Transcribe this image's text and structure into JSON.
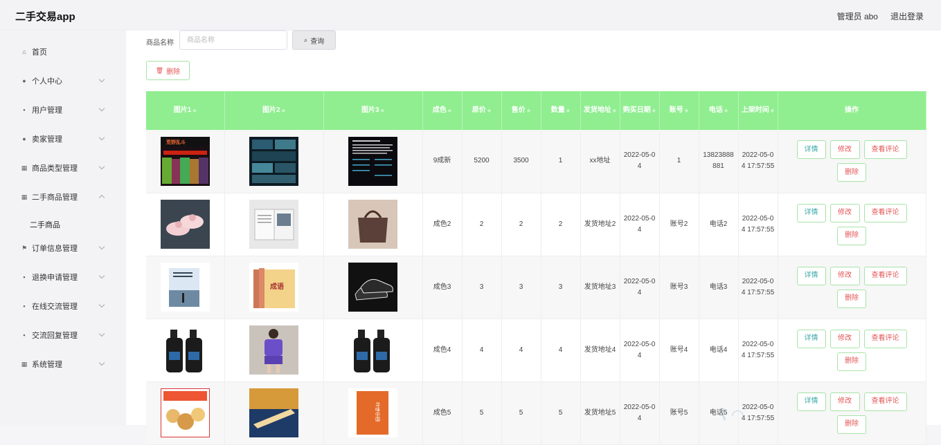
{
  "app": {
    "title": "二手交易app"
  },
  "header": {
    "user": "管理员 abo",
    "logout": "退出登录"
  },
  "sidebar": {
    "items": [
      {
        "label": "首页",
        "icon": "home-icon",
        "has_children": false
      },
      {
        "label": "个人中心",
        "icon": "user-icon",
        "has_children": true
      },
      {
        "label": "用户管理",
        "icon": "user-manage-icon",
        "has_children": true
      },
      {
        "label": "卖家管理",
        "icon": "seller-icon",
        "has_children": true
      },
      {
        "label": "商品类型管理",
        "icon": "category-icon",
        "has_children": true
      },
      {
        "label": "二手商品管理",
        "icon": "goods-icon",
        "has_children": true
      },
      {
        "label": "订单信息管理",
        "icon": "flag-icon",
        "has_children": true
      },
      {
        "label": "退换申请管理",
        "icon": "return-icon",
        "has_children": true
      },
      {
        "label": "在线交流管理",
        "icon": "chat-icon",
        "has_children": true
      },
      {
        "label": "交流回复管理",
        "icon": "reply-icon",
        "has_children": true
      },
      {
        "label": "系统管理",
        "icon": "system-icon",
        "has_children": true
      }
    ],
    "submenu": {
      "label": "二手商品"
    }
  },
  "search": {
    "label": "商品名称",
    "placeholder": "商品名称",
    "value": "",
    "button": "查询"
  },
  "toolbar": {
    "delete_label": "删除"
  },
  "table": {
    "columns": [
      "图片1",
      "图片2",
      "图片3",
      "成色",
      "原价",
      "售价",
      "数量",
      "发货地址",
      "购买日期",
      "账号",
      "电话",
      "上架时间",
      "操作"
    ],
    "actions": {
      "detail": "详情",
      "edit": "修改",
      "review": "查看评论",
      "remove": "删除"
    },
    "rows": [
      {
        "condition": "9成新",
        "original_price": "5200",
        "sale_price": "3500",
        "quantity": "1",
        "address": "xx地址",
        "buy_date": "2022-05-04",
        "account": "1",
        "phone": "13823888881",
        "listed_time": "2022-05-04 17:57:55",
        "images": [
          "game-poster",
          "dark-tech-collage",
          "text-screenshot"
        ]
      },
      {
        "condition": "成色2",
        "original_price": "2",
        "sale_price": "2",
        "quantity": "2",
        "address": "发货地址2",
        "buy_date": "2022-05-04",
        "account": "账号2",
        "phone": "电话2",
        "listed_time": "2022-05-04 17:57:55",
        "images": [
          "pink-shoes",
          "open-magazine",
          "brown-handbag"
        ]
      },
      {
        "condition": "成色3",
        "original_price": "3",
        "sale_price": "3",
        "quantity": "3",
        "address": "发货地址3",
        "buy_date": "2022-05-04",
        "account": "账号3",
        "phone": "电话3",
        "listed_time": "2022-05-04 17:57:55",
        "images": [
          "book-cover",
          "idiom-books",
          "black-sneakers"
        ]
      },
      {
        "condition": "成色4",
        "original_price": "4",
        "sale_price": "4",
        "quantity": "4",
        "address": "发货地址4",
        "buy_date": "2022-05-04",
        "account": "账号4",
        "phone": "电话4",
        "listed_time": "2022-05-04 17:57:55",
        "images": [
          "mens-facewash",
          "purple-outfit",
          "mens-facewash"
        ]
      },
      {
        "condition": "成色5",
        "original_price": "5",
        "sale_price": "5",
        "quantity": "5",
        "address": "发货地址5",
        "buy_date": "2022-05-04",
        "account": "账号5",
        "phone": "电话5",
        "listed_time": "2022-05-04 17:57:55",
        "images": [
          "snack-box",
          "kayak-painting",
          "orange-book"
        ]
      }
    ]
  },
  "colors": {
    "header_green": "#90ee90",
    "danger": "#e45656",
    "teal": "#3aa7a7",
    "border_green": "#a6e3a6"
  }
}
